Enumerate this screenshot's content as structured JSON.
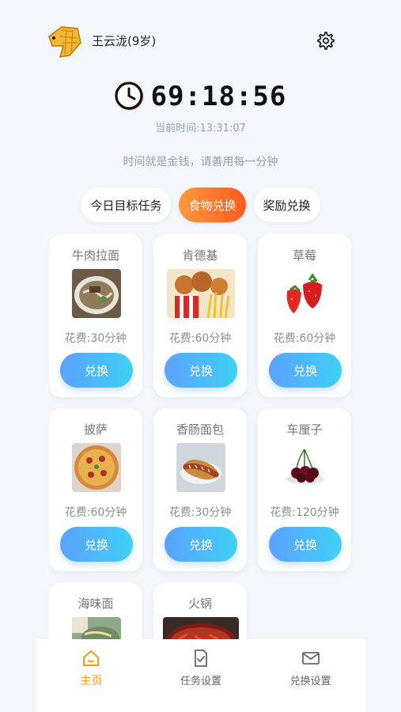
{
  "user": {
    "name": "王云泷(9岁)"
  },
  "timer": {
    "value": "69:18:56",
    "now": "当前时间:13:31:07"
  },
  "motto": "时间就是金钱，请善用每一分钟",
  "tabs": [
    {
      "label": "今日目标任务"
    },
    {
      "label": "食物兑换"
    },
    {
      "label": "奖励兑换"
    }
  ],
  "active_tab": "食物兑换",
  "foods": [
    {
      "name": "牛肉拉面",
      "cost": "花费:30分钟",
      "button": "兑换"
    },
    {
      "name": "肯德基",
      "cost": "花费:60分钟",
      "button": "兑换"
    },
    {
      "name": "草莓",
      "cost": "花费:60分钟",
      "button": "兑换"
    },
    {
      "name": "披萨",
      "cost": "花费:60分钟",
      "button": "兑换"
    },
    {
      "name": "香肠面包",
      "cost": "花费:30分钟",
      "button": "兑换"
    },
    {
      "name": "车厘子",
      "cost": "花费:120分钟",
      "button": "兑换"
    },
    {
      "name": "海味面"
    },
    {
      "name": "火锅"
    }
  ],
  "nav": [
    {
      "label": "主页",
      "icon": "home-icon"
    },
    {
      "label": "任务设置",
      "icon": "task-icon"
    },
    {
      "label": "兑换设置",
      "icon": "mail-icon"
    }
  ],
  "colors": {
    "accent_orange": "#ff5a1f",
    "button_blue": "#5aa2ff",
    "nav_active": "#f29a1e"
  }
}
